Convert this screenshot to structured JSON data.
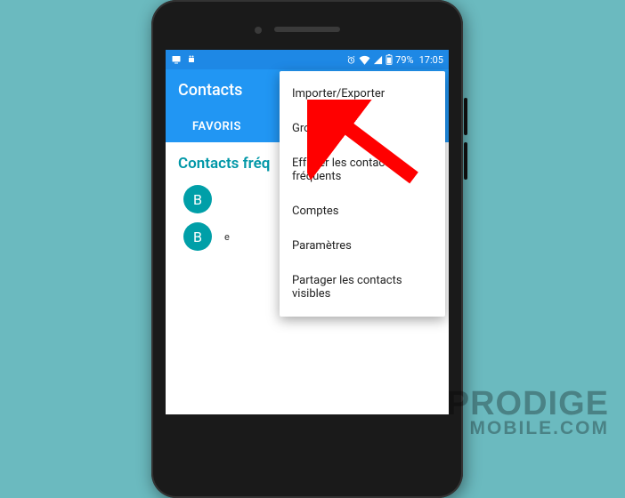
{
  "statusbar": {
    "battery_pct": "79%",
    "time": "17:05"
  },
  "appbar": {
    "title": "Contacts"
  },
  "tabs": {
    "favoris": "FAVORIS"
  },
  "section": {
    "header_visible": "Contacts fréq",
    "rows": [
      {
        "initial": "B"
      },
      {
        "initial": "B",
        "hint": "e"
      }
    ]
  },
  "menu": {
    "items": [
      "Importer/Exporter",
      "Groupes",
      "Effacer les contacts fréquents",
      "Comptes",
      "Paramètres",
      "Partager les contacts visibles"
    ]
  },
  "watermark": {
    "line1": "PRODIGE",
    "line2": "MOBILE.COM"
  },
  "colors": {
    "bg": "#6bbabf",
    "primary": "#2196f3",
    "accent": "#0097a7",
    "arrow": "#ff0000"
  }
}
